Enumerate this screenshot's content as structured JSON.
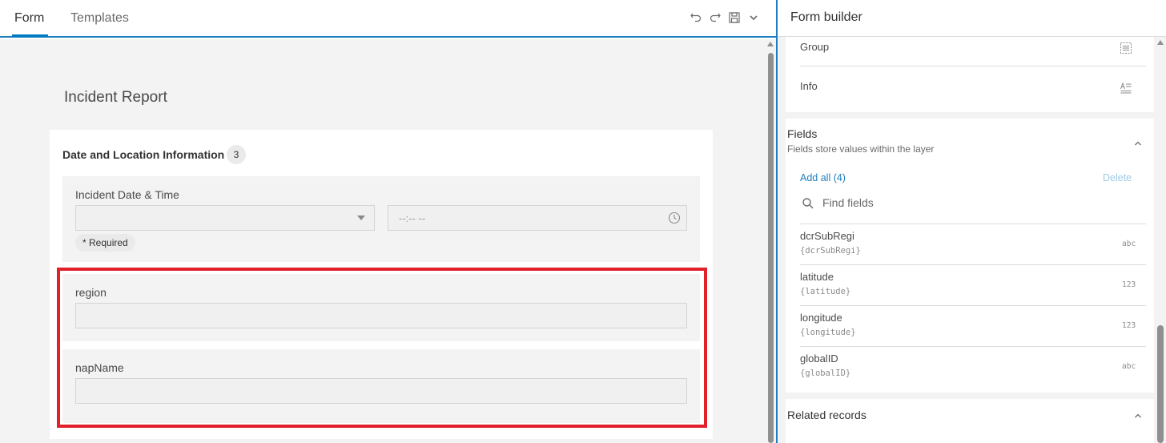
{
  "tabs": [
    {
      "label": "Form",
      "active": true
    },
    {
      "label": "Templates",
      "active": false
    }
  ],
  "toolbar_icons": [
    "undo-icon",
    "redo-icon",
    "save-icon",
    "chevron-down-icon"
  ],
  "form": {
    "title": "Incident Report",
    "group": {
      "title": "Date and Location Information",
      "count": "3",
      "elements": [
        {
          "label": "Incident Date & Time",
          "date_value": "",
          "time_placeholder": "--:-- --",
          "required_text": "* Required"
        },
        {
          "label": "region",
          "value": ""
        },
        {
          "label": "napName",
          "value": ""
        }
      ]
    }
  },
  "builder": {
    "title": "Form builder",
    "elements": [
      {
        "label": "Group",
        "icon": "group-icon"
      },
      {
        "label": "Info",
        "icon": "text-info-icon"
      }
    ],
    "fields_section": {
      "title": "Fields",
      "subtitle": "Fields store values within the layer",
      "add_all": "Add all (4)",
      "delete": "Delete",
      "search_placeholder": "Find fields",
      "items": [
        {
          "name": "dcrSubRegi",
          "key": "{dcrSubRegi}",
          "type": "abc"
        },
        {
          "name": "latitude",
          "key": "{latitude}",
          "type": "123"
        },
        {
          "name": "longitude",
          "key": "{longitude}",
          "type": "123"
        },
        {
          "name": "globalID",
          "key": "{globalID}",
          "type": "abc"
        }
      ]
    },
    "related_section": {
      "title": "Related records"
    }
  },
  "colors": {
    "accent": "#007ac2",
    "highlight": "#e0202b",
    "link": "#1d7fc1"
  }
}
